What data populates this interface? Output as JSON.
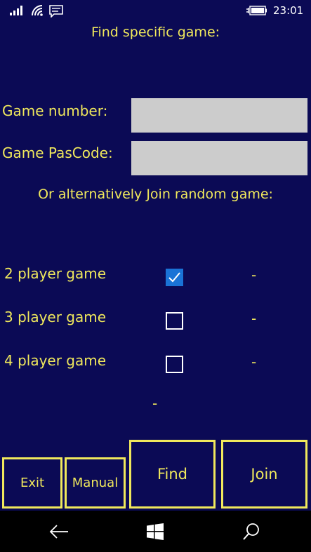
{
  "status_bar": {
    "time": "23:01",
    "icons": [
      "signal-icon",
      "wifi-icon",
      "message-icon",
      "battery-charging-icon"
    ]
  },
  "find": {
    "heading": "Find specific game:",
    "game_number_label": "Game number:",
    "game_number_value": "",
    "passcode_label": "Game PasCode:",
    "passcode_value": ""
  },
  "random": {
    "heading": "Or alternatively Join random game:",
    "options": [
      {
        "label": "2 player game",
        "checked": true,
        "count": "-"
      },
      {
        "label": "3 player game",
        "checked": false,
        "count": "-"
      },
      {
        "label": "4 player game",
        "checked": false,
        "count": "-"
      }
    ],
    "status": "-"
  },
  "buttons": {
    "exit": "Exit",
    "manual": "Manual",
    "find": "Find",
    "join": "Join"
  },
  "nav": {
    "icons": [
      "back-arrow-icon",
      "windows-icon",
      "search-icon"
    ]
  },
  "colors": {
    "background": "#0b0a55",
    "accent": "#f0e85c",
    "input": "#cccccc",
    "checkbox_checked": "#1a73d6"
  }
}
